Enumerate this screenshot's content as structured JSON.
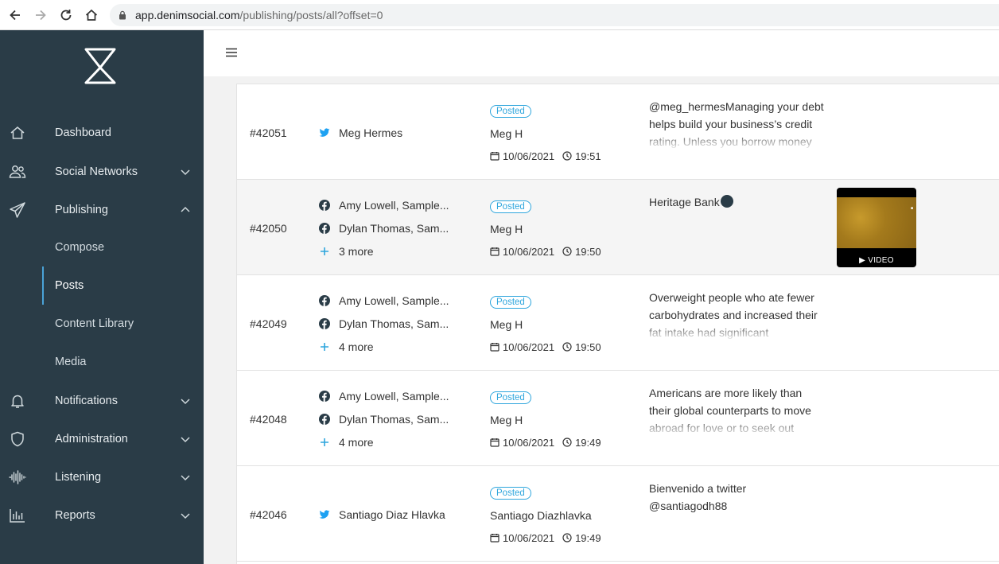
{
  "browser": {
    "url_host": "app.denimsocial.com",
    "url_path": "/publishing/posts/all?offset=0"
  },
  "sidebar": {
    "items": [
      {
        "label": "Dashboard",
        "icon": "home-icon"
      },
      {
        "label": "Social Networks",
        "icon": "users-icon"
      },
      {
        "label": "Publishing",
        "icon": "paper-plane-icon"
      },
      {
        "label": "Notifications",
        "icon": "bell-icon"
      },
      {
        "label": "Administration",
        "icon": "shield-icon"
      },
      {
        "label": "Listening",
        "icon": "waveform-icon"
      },
      {
        "label": "Reports",
        "icon": "bar-chart-icon"
      }
    ],
    "publishing_sub": [
      {
        "label": "Compose"
      },
      {
        "label": "Posts"
      },
      {
        "label": "Content Library"
      },
      {
        "label": "Media"
      }
    ]
  },
  "colors": {
    "sidebar_bg": "#2a3c47",
    "accent": "#2fa6dd",
    "twitter": "#1da1f2",
    "facebook": "#2a3c47"
  },
  "posts": [
    {
      "id": "#42051",
      "networks": [
        {
          "type": "twitter-icon",
          "name": "Meg Hermes"
        }
      ],
      "more": "",
      "status": "Posted",
      "author": "Meg H",
      "date": "10/06/2021",
      "time": "19:51",
      "message": "@meg_hermesManaging your debt helps build your business’s credit rating. Unless you borrow money and pay it back on time"
    },
    {
      "id": "#42050",
      "networks": [
        {
          "type": "facebook-icon",
          "name": "Amy Lowell, Sample..."
        },
        {
          "type": "facebook-icon",
          "name": "Dylan Thomas, Sam..."
        }
      ],
      "more": "3 more",
      "status": "Posted",
      "author": "Meg H",
      "date": "10/06/2021",
      "time": "19:50",
      "message": "Heritage Bank",
      "media_label": "▶ VIDEO"
    },
    {
      "id": "#42049",
      "networks": [
        {
          "type": "facebook-icon",
          "name": "Amy Lowell, Sample..."
        },
        {
          "type": "facebook-icon",
          "name": "Dylan Thomas, Sam..."
        }
      ],
      "more": "4 more",
      "status": "Posted",
      "author": "Meg H",
      "date": "10/06/2021",
      "time": "19:50",
      "message": "Overweight people who ate fewer carbohydrates and increased their fat intake had significant improvements in their"
    },
    {
      "id": "#42048",
      "networks": [
        {
          "type": "facebook-icon",
          "name": "Amy Lowell, Sample..."
        },
        {
          "type": "facebook-icon",
          "name": "Dylan Thomas, Sam..."
        }
      ],
      "more": "4 more",
      "status": "Posted",
      "author": "Meg H",
      "date": "10/06/2021",
      "time": "19:49",
      "message": "Americans are more likely than their global counterparts to move abroad for love or to seek out adventure, according to a new"
    },
    {
      "id": "#42046",
      "networks": [
        {
          "type": "twitter-icon",
          "name": "Santiago Diaz Hlavka"
        }
      ],
      "more": "",
      "status": "Posted",
      "author": "Santiago Diazhlavka",
      "date": "10/06/2021",
      "time": "19:49",
      "message": "Bienvenido a twitter @santiagodh88"
    }
  ]
}
